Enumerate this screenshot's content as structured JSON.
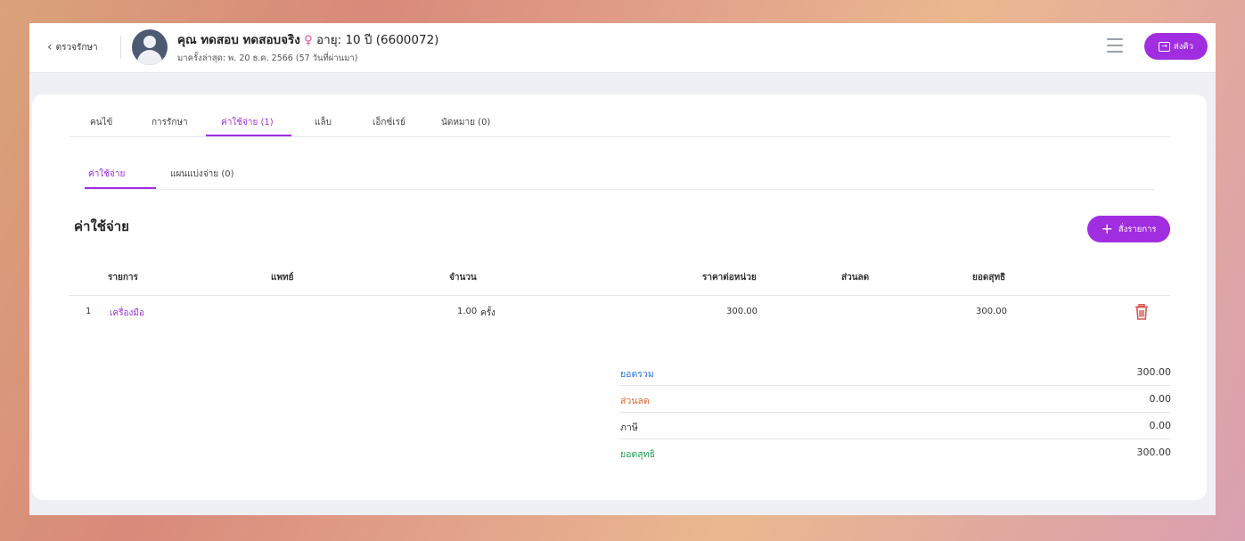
{
  "header": {
    "back_label": "ตรวจรักษา",
    "patient_name": "คุณ ทดสอบ ทดสอบจริง",
    "gender_symbol": "♀",
    "age_text": "อายุ: 10 ปี (6600072)",
    "last_visit": "มาครั้งล่าสุด: พ. 20 ธ.ค. 2566 (57 วันที่ผ่านมา)",
    "send_label": "ส่งคิว"
  },
  "tabs": [
    {
      "label": "คนไข้"
    },
    {
      "label": "การรักษา"
    },
    {
      "label": "ค่าใช้จ่าย (1)"
    },
    {
      "label": "แล็บ"
    },
    {
      "label": "เอ็กซ์เรย์"
    },
    {
      "label": "นัดหมาย (0)"
    }
  ],
  "subtabs": [
    {
      "label": "ค่าใช้จ่าย"
    },
    {
      "label": "แผนแบ่งจ่าย (0)"
    }
  ],
  "section": {
    "title": "ค่าใช้จ่าย",
    "add_label": "สั่งรายการ"
  },
  "table": {
    "headers": [
      "รายการ",
      "แพทย์",
      "จำนวน",
      "ราคาต่อหน่วย",
      "ส่วนลด",
      "ยอดสุทธิ"
    ],
    "rows": [
      {
        "index": "1",
        "item": "เครื่องมือ",
        "doctor": "",
        "qty": "1.00",
        "unit": "ครั้ง",
        "unit_price": "300.00",
        "discount": "",
        "net": "300.00"
      }
    ]
  },
  "summary": [
    {
      "label": "ยอดรวม",
      "value": "300.00"
    },
    {
      "label": "ส่วนลด",
      "value": "0.00"
    },
    {
      "label": "ภาษี",
      "value": "0.00"
    },
    {
      "label": "ยอดสุทธิ",
      "value": "300.00"
    }
  ],
  "colors": {
    "accent": "#a02ee0",
    "total": "#2b6fd6",
    "discount": "#e0662d",
    "net": "#1f9d55",
    "delete": "#d9534f"
  },
  "icons": [
    "chevron-left-icon",
    "avatar-icon",
    "female-icon",
    "menu-icon",
    "logout-icon",
    "plus-icon",
    "trash-icon"
  ]
}
